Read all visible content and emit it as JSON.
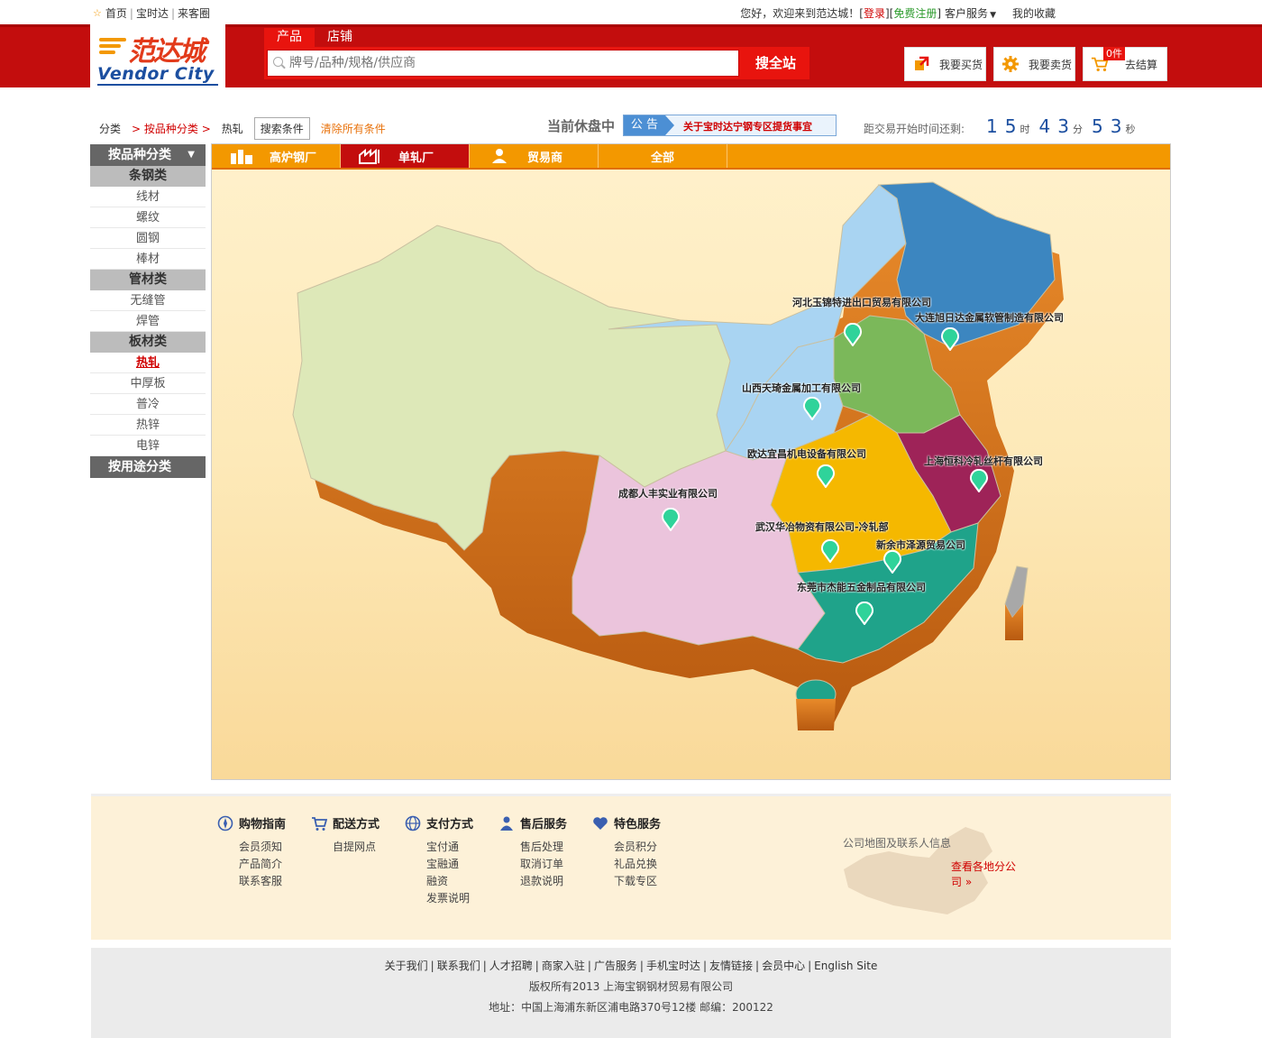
{
  "topbar": {
    "left_links": [
      "首页",
      "宝时达",
      "来客圈"
    ],
    "welcome": "您好，欢迎来到范达城！",
    "login": "登录",
    "register": "免费注册",
    "customer_service": "客户服务",
    "favorites": "我的收藏"
  },
  "logo": {
    "cn": "范达城",
    "en": "Vendor City"
  },
  "search": {
    "tabs": [
      "产品",
      "店铺"
    ],
    "placeholder": "牌号/品种/规格/供应商",
    "button": "搜全站"
  },
  "header_buttons": {
    "buy": "我要买货",
    "sell": "我要卖货",
    "cart_count": "0件",
    "checkout": "去结算"
  },
  "breadcrumb": {
    "root": "分类",
    "level1": "> 按品种分类 >",
    "current": "热轧",
    "search_conditions": "搜索条件",
    "clear": "清除所有条件"
  },
  "market": {
    "status": "当前休盘中",
    "notice_label": "公 告",
    "notice_text": "关于宝时达宁钢专区提货事宜",
    "countdown_label": "距交易开始时间还剩:",
    "hours": [
      "1",
      "5"
    ],
    "minutes": [
      "4",
      "3"
    ],
    "seconds": [
      "5",
      "3"
    ],
    "unit_h": "时",
    "unit_m": "分",
    "unit_s": "秒"
  },
  "sidebar": {
    "header": "按品种分类",
    "groups": [
      {
        "title": "条钢类",
        "items": [
          "线材",
          "螺纹",
          "圆钢",
          "棒材"
        ]
      },
      {
        "title": "管材类",
        "items": [
          "无缝管",
          "焊管"
        ]
      },
      {
        "title": "板材类",
        "items": [
          "热轧",
          "中厚板",
          "普冷",
          "热锌",
          "电锌"
        ]
      }
    ],
    "active_item": "热轧",
    "footer": "按用途分类"
  },
  "map": {
    "tabs": [
      "高炉钢厂",
      "单轧厂",
      "贸易商",
      "全部"
    ],
    "active_tab": "单轧厂",
    "pins": [
      "河北玉锦特进出口贸易有限公司",
      "大连旭日达金属软管制造有限公司",
      "山西天琦金属加工有限公司",
      "欧达宜昌机电设备有限公司",
      "上海恒科冷轧丝杆有限公司",
      "成都人丰实业有限公司",
      "武汉华冶物资有限公司-冷轧部",
      "新余市泽源贸易公司",
      "东莞市杰能五金制品有限公司"
    ],
    "pin_color": "#2fd39a"
  },
  "services": [
    {
      "title": "购物指南",
      "icon": "compass-icon",
      "links": [
        "会员须知",
        "产品简介",
        "联系客服"
      ]
    },
    {
      "title": "配送方式",
      "icon": "cart-icon",
      "links": [
        "自提网点"
      ]
    },
    {
      "title": "支付方式",
      "icon": "globe-icon",
      "links": [
        "宝付通",
        "宝融通",
        "融资",
        "发票说明"
      ]
    },
    {
      "title": "售后服务",
      "icon": "person-icon",
      "links": [
        "售后处理",
        "取消订单",
        "退款说明"
      ]
    },
    {
      "title": "特色服务",
      "icon": "heart-icon",
      "links": [
        "会员积分",
        "礼品兑换",
        "下载专区"
      ]
    }
  ],
  "company_map": {
    "title": "公司地图及联系人信息",
    "link": "查看各地分公司 »"
  },
  "footer": {
    "links": [
      "关于我们",
      "联系我们",
      "人才招聘",
      "商家入驻",
      "广告服务",
      "手机宝时达",
      "友情链接",
      "会员中心",
      "English Site"
    ],
    "copyright": "版权所有2013 上海宝钢钢材贸易有限公司",
    "address": "地址：中国上海浦东新区浦电路370号12楼 邮编：200122"
  },
  "colors": {
    "brand_red": "#c30d0d",
    "accent_orange": "#f39800",
    "link_blue": "#1c4fa0"
  }
}
